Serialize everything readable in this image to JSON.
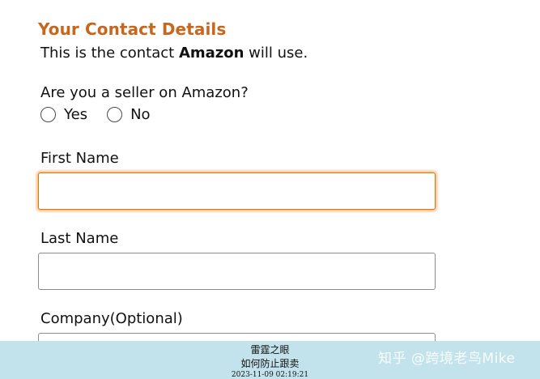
{
  "form": {
    "title": "Your Contact Details",
    "subtitle_prefix": "This is the contact ",
    "subtitle_bold": "Amazon",
    "subtitle_suffix": " will use.",
    "seller_question": "Are you a seller on Amazon?",
    "seller_options": [
      "Yes",
      "No"
    ],
    "first_name_label": "First Name",
    "first_name_value": "",
    "last_name_label": "Last Name",
    "last_name_value": "",
    "company_label": "Company(Optional)",
    "company_value": ""
  },
  "overlay": {
    "line1": "雷霆之眼",
    "line2": "如何防止跟卖",
    "line3": "2023-11-09 02:19:21",
    "watermark": "知乎 @跨境老鸟Mike"
  },
  "colors": {
    "title": "#c7671d",
    "focus_border": "#e77600",
    "overlay_band": "#c2e2ec"
  }
}
